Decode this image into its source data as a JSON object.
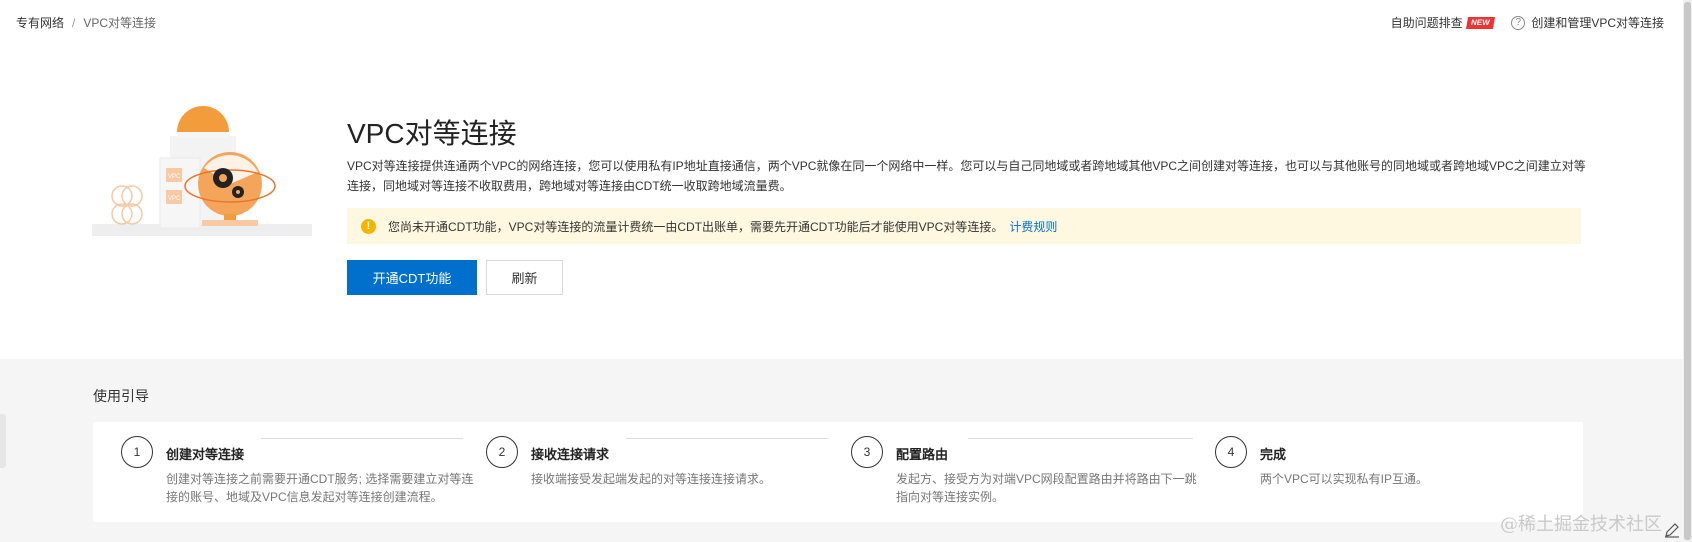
{
  "breadcrumb": {
    "root": "专有网络",
    "separator": "/",
    "current": "VPC对等连接"
  },
  "top_links": {
    "troubleshoot": "自助问题排查",
    "new_badge": "NEW",
    "help": "创建和管理VPC对等连接"
  },
  "illustration": {
    "vpc_label_1": "VPC",
    "vpc_label_2": "VPC"
  },
  "hero": {
    "title": "VPC对等连接",
    "description": "VPC对等连接提供连通两个VPC的网络连接，您可以使用私有IP地址直接通信，两个VPC就像在同一个网络中一样。您可以与自己同地域或者跨地域其他VPC之间创建对等连接，也可以与其他账号的同地域或者跨地域VPC之间建立对等连接，同地域对等连接不收取费用，跨地域对等连接由CDT统一收取跨地域流量费。"
  },
  "notice": {
    "icon": "warning-icon",
    "text": "您尚未开通CDT功能，VPC对等连接的流量计费统一由CDT出账单，需要先开通CDT功能后才能使用VPC对等连接。",
    "link": "计费规则"
  },
  "buttons": {
    "enable_cdt": "开通CDT功能",
    "refresh": "刷新"
  },
  "guide": {
    "title": "使用引导",
    "steps": [
      {
        "num": "1",
        "name": "创建对等连接",
        "desc": "创建对等连接之前需要开通CDT服务; 选择需要建立对等连接的账号、地域及VPC信息发起对等连接创建流程。"
      },
      {
        "num": "2",
        "name": "接收连接请求",
        "desc": "接收端接受发起端发起的对等连接连接请求。"
      },
      {
        "num": "3",
        "name": "配置路由",
        "desc": "发起方、接受方为对端VPC网段配置路由并将路由下一跳指向对等连接实例。"
      },
      {
        "num": "4",
        "name": "完成",
        "desc": "两个VPC可以实现私有IP互通。"
      }
    ]
  },
  "watermark": "@稀土掘金技术社区",
  "colors": {
    "primary": "#0070cc",
    "notice_bg": "#fff8e1",
    "warning": "#f5b400",
    "badge": "#e33333"
  }
}
